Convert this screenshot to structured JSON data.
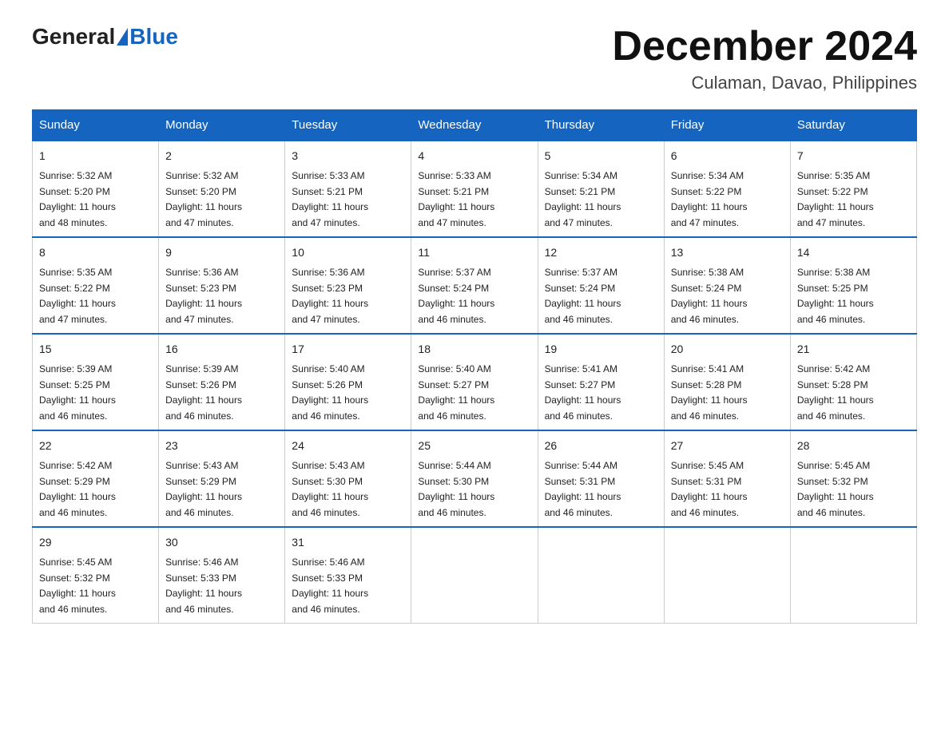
{
  "logo": {
    "general": "General",
    "blue": "Blue"
  },
  "title": "December 2024",
  "subtitle": "Culaman, Davao, Philippines",
  "days_of_week": [
    "Sunday",
    "Monday",
    "Tuesday",
    "Wednesday",
    "Thursday",
    "Friday",
    "Saturday"
  ],
  "weeks": [
    [
      {
        "day": "1",
        "sunrise": "5:32 AM",
        "sunset": "5:20 PM",
        "daylight": "11 hours and 48 minutes."
      },
      {
        "day": "2",
        "sunrise": "5:32 AM",
        "sunset": "5:20 PM",
        "daylight": "11 hours and 47 minutes."
      },
      {
        "day": "3",
        "sunrise": "5:33 AM",
        "sunset": "5:21 PM",
        "daylight": "11 hours and 47 minutes."
      },
      {
        "day": "4",
        "sunrise": "5:33 AM",
        "sunset": "5:21 PM",
        "daylight": "11 hours and 47 minutes."
      },
      {
        "day": "5",
        "sunrise": "5:34 AM",
        "sunset": "5:21 PM",
        "daylight": "11 hours and 47 minutes."
      },
      {
        "day": "6",
        "sunrise": "5:34 AM",
        "sunset": "5:22 PM",
        "daylight": "11 hours and 47 minutes."
      },
      {
        "day": "7",
        "sunrise": "5:35 AM",
        "sunset": "5:22 PM",
        "daylight": "11 hours and 47 minutes."
      }
    ],
    [
      {
        "day": "8",
        "sunrise": "5:35 AM",
        "sunset": "5:22 PM",
        "daylight": "11 hours and 47 minutes."
      },
      {
        "day": "9",
        "sunrise": "5:36 AM",
        "sunset": "5:23 PM",
        "daylight": "11 hours and 47 minutes."
      },
      {
        "day": "10",
        "sunrise": "5:36 AM",
        "sunset": "5:23 PM",
        "daylight": "11 hours and 47 minutes."
      },
      {
        "day": "11",
        "sunrise": "5:37 AM",
        "sunset": "5:24 PM",
        "daylight": "11 hours and 46 minutes."
      },
      {
        "day": "12",
        "sunrise": "5:37 AM",
        "sunset": "5:24 PM",
        "daylight": "11 hours and 46 minutes."
      },
      {
        "day": "13",
        "sunrise": "5:38 AM",
        "sunset": "5:24 PM",
        "daylight": "11 hours and 46 minutes."
      },
      {
        "day": "14",
        "sunrise": "5:38 AM",
        "sunset": "5:25 PM",
        "daylight": "11 hours and 46 minutes."
      }
    ],
    [
      {
        "day": "15",
        "sunrise": "5:39 AM",
        "sunset": "5:25 PM",
        "daylight": "11 hours and 46 minutes."
      },
      {
        "day": "16",
        "sunrise": "5:39 AM",
        "sunset": "5:26 PM",
        "daylight": "11 hours and 46 minutes."
      },
      {
        "day": "17",
        "sunrise": "5:40 AM",
        "sunset": "5:26 PM",
        "daylight": "11 hours and 46 minutes."
      },
      {
        "day": "18",
        "sunrise": "5:40 AM",
        "sunset": "5:27 PM",
        "daylight": "11 hours and 46 minutes."
      },
      {
        "day": "19",
        "sunrise": "5:41 AM",
        "sunset": "5:27 PM",
        "daylight": "11 hours and 46 minutes."
      },
      {
        "day": "20",
        "sunrise": "5:41 AM",
        "sunset": "5:28 PM",
        "daylight": "11 hours and 46 minutes."
      },
      {
        "day": "21",
        "sunrise": "5:42 AM",
        "sunset": "5:28 PM",
        "daylight": "11 hours and 46 minutes."
      }
    ],
    [
      {
        "day": "22",
        "sunrise": "5:42 AM",
        "sunset": "5:29 PM",
        "daylight": "11 hours and 46 minutes."
      },
      {
        "day": "23",
        "sunrise": "5:43 AM",
        "sunset": "5:29 PM",
        "daylight": "11 hours and 46 minutes."
      },
      {
        "day": "24",
        "sunrise": "5:43 AM",
        "sunset": "5:30 PM",
        "daylight": "11 hours and 46 minutes."
      },
      {
        "day": "25",
        "sunrise": "5:44 AM",
        "sunset": "5:30 PM",
        "daylight": "11 hours and 46 minutes."
      },
      {
        "day": "26",
        "sunrise": "5:44 AM",
        "sunset": "5:31 PM",
        "daylight": "11 hours and 46 minutes."
      },
      {
        "day": "27",
        "sunrise": "5:45 AM",
        "sunset": "5:31 PM",
        "daylight": "11 hours and 46 minutes."
      },
      {
        "day": "28",
        "sunrise": "5:45 AM",
        "sunset": "5:32 PM",
        "daylight": "11 hours and 46 minutes."
      }
    ],
    [
      {
        "day": "29",
        "sunrise": "5:45 AM",
        "sunset": "5:32 PM",
        "daylight": "11 hours and 46 minutes."
      },
      {
        "day": "30",
        "sunrise": "5:46 AM",
        "sunset": "5:33 PM",
        "daylight": "11 hours and 46 minutes."
      },
      {
        "day": "31",
        "sunrise": "5:46 AM",
        "sunset": "5:33 PM",
        "daylight": "11 hours and 46 minutes."
      },
      null,
      null,
      null,
      null
    ]
  ],
  "labels": {
    "sunrise": "Sunrise:",
    "sunset": "Sunset:",
    "daylight": "Daylight:"
  }
}
